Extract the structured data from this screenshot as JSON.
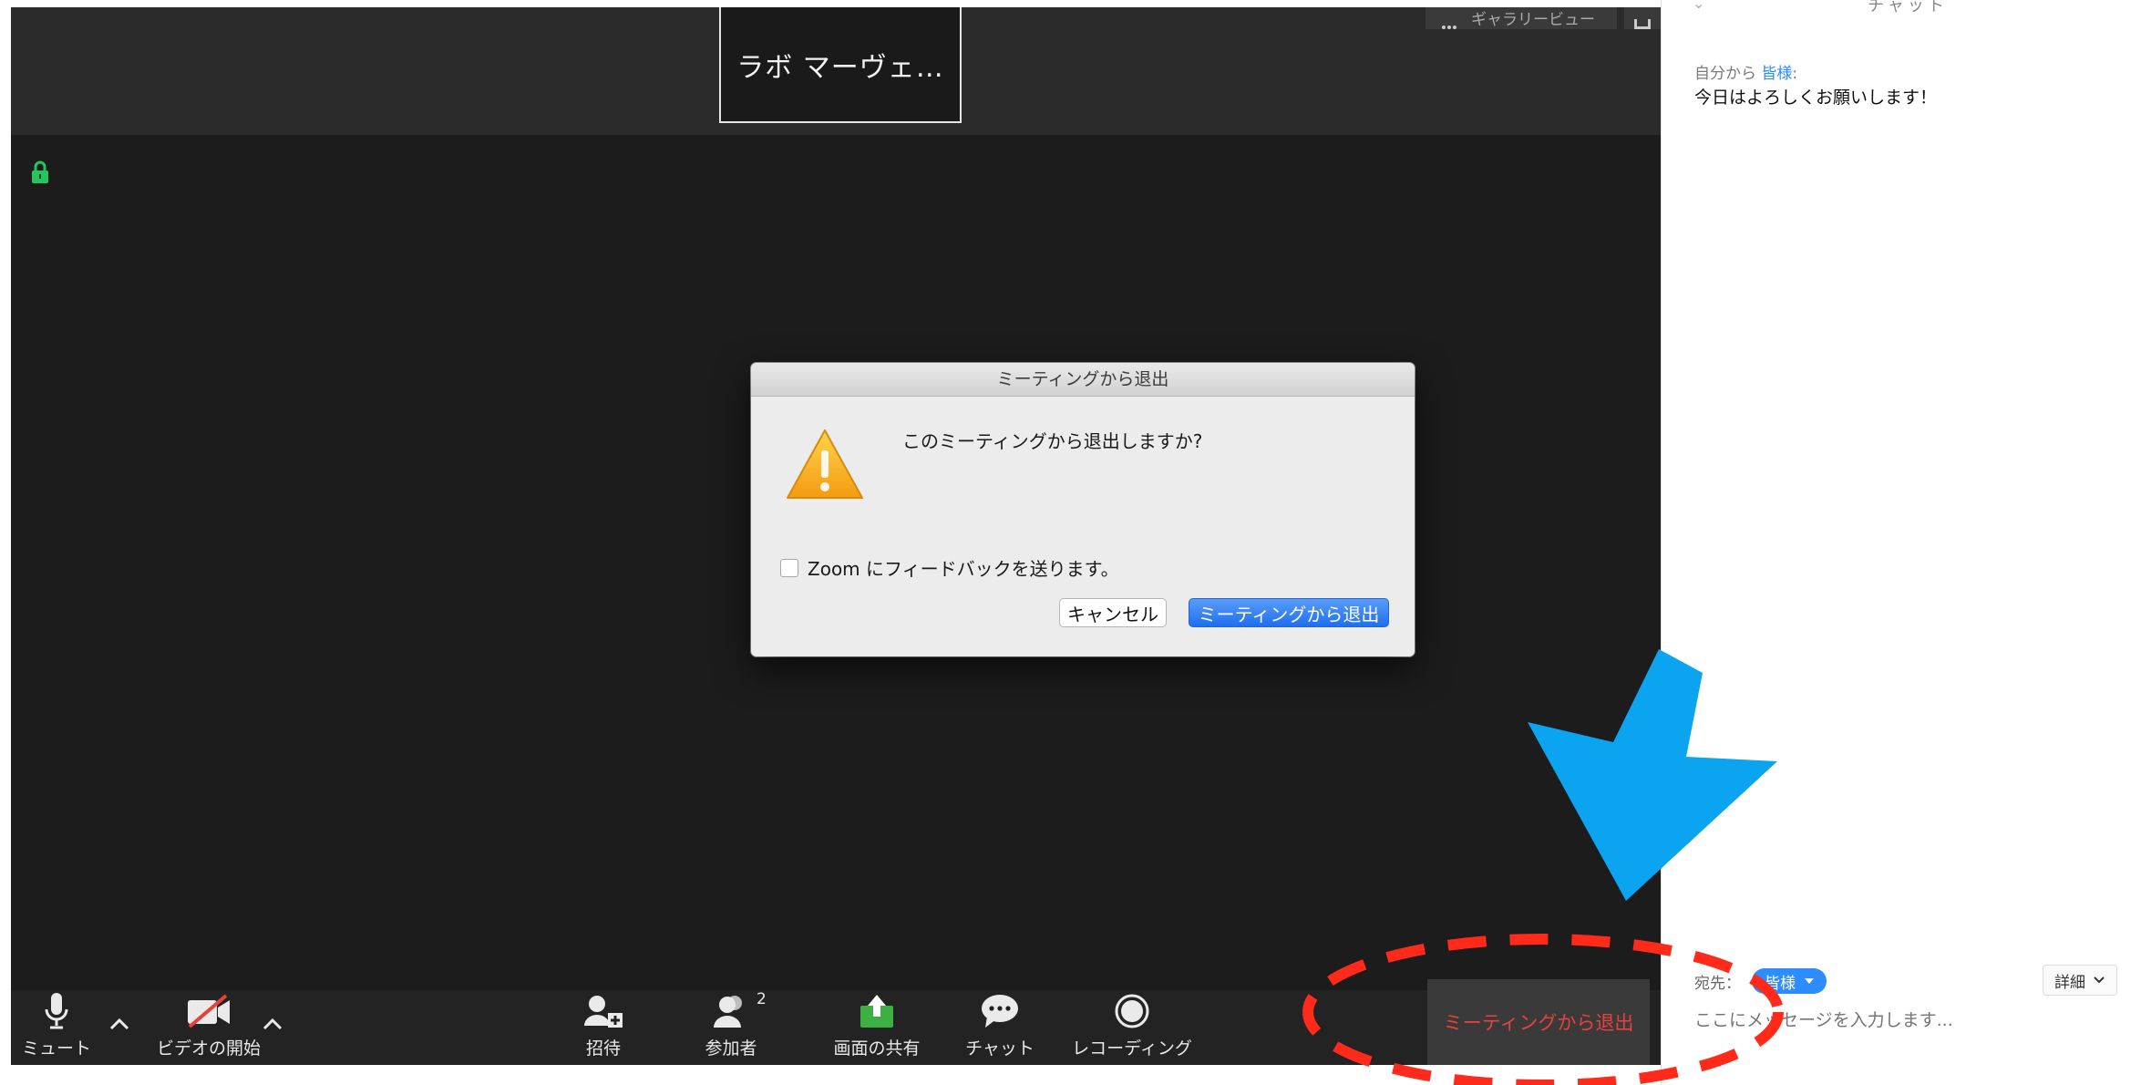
{
  "meeting": {
    "participant_name": "ラボ マーヴェ…",
    "view_label": "ギャラリービュー"
  },
  "toolbar": {
    "mute": "ミュート",
    "start_video": "ビデオの開始",
    "invite": "招待",
    "participants": "参加者",
    "participant_count": "2",
    "share_screen": "画面の共有",
    "chat": "チャット",
    "recording": "レコーディング",
    "leave_meeting": "ミーティングから退出"
  },
  "dialog": {
    "title": "ミーティングから退出",
    "message": "このミーティングから退出しますか?",
    "feedback_label": "Zoom にフィードバックを送ります。",
    "cancel": "キャンセル",
    "confirm": "ミーティングから退出"
  },
  "chat": {
    "title": "チャット",
    "sender_prefix": "自分から",
    "recipient_name": "皆様",
    "message": "今日はよろしくお願いします！",
    "to_label": "宛先：",
    "recipient_pill": "皆様",
    "details": "詳細",
    "input_placeholder": "ここにメッセージを入力します..."
  },
  "colors": {
    "meeting_bg": "#1c1c1c",
    "leave_text": "#e8403b",
    "primary_button": "#1e6ff0",
    "share_icon": "#3cb043",
    "lock_icon": "#22c55e",
    "annotation_arrow": "#0aa4f0",
    "annotation_circle": "#ff2a1a",
    "recipient_pill": "#2d8cff"
  },
  "icons": [
    "lock-icon",
    "microphone-icon",
    "video-off-icon",
    "caret-up-icon",
    "invite-icon",
    "participants-icon",
    "share-screen-icon",
    "chat-icon",
    "record-icon",
    "warning-icon",
    "arrow-annotation",
    "dashed-circle-annotation"
  ]
}
